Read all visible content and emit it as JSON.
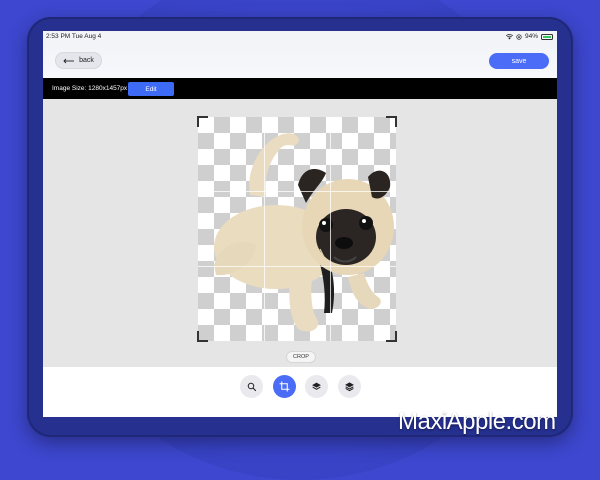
{
  "status_bar": {
    "time_date": "2:53 PM   Tue Aug 4",
    "battery_percent": "94%"
  },
  "header": {
    "back_label": "back",
    "save_label": "save"
  },
  "info_bar": {
    "image_size": "Image Size: 1280x1457px",
    "edit_label": "Edit"
  },
  "canvas": {
    "crop_label": "CROP"
  },
  "toolbar": {
    "tools": [
      {
        "icon": "search-icon"
      },
      {
        "icon": "crop-icon",
        "active": true
      },
      {
        "icon": "layers-icon"
      },
      {
        "icon": "layers-alt-icon"
      }
    ]
  },
  "colors": {
    "accent": "#4a6cf7",
    "background": "#3d47cf"
  },
  "watermark": "MaxiApple.com"
}
